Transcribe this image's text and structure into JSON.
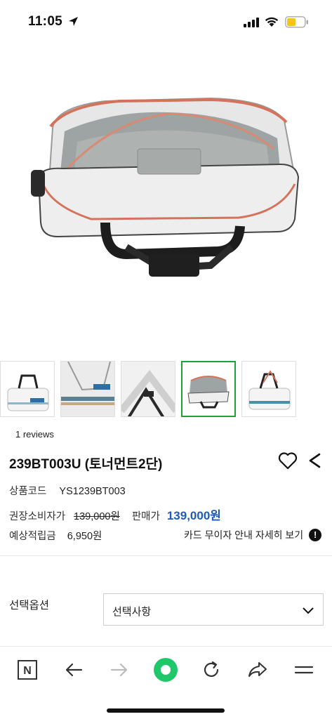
{
  "status_bar": {
    "time": "11:05"
  },
  "gallery": {
    "thumbnail_count": 5,
    "active_index": 3
  },
  "product": {
    "reviews": "1 reviews",
    "name": "239BT003U (토너먼트2단)",
    "code_label": "상품코드",
    "code_value": "YS1239BT003",
    "list_price_label": "권장소비자가",
    "list_price": "139,000원",
    "sale_price_label": "판매가",
    "sale_price": "139,000원",
    "points_label": "예상적립금",
    "points_value": "6,950원",
    "card_info": "카드 무이자 안내 자세히 보기",
    "info_icon_text": "!"
  },
  "options": {
    "label": "선택옵션",
    "selected": "선택사항"
  },
  "colors": {
    "accent_blue": "#1e5bb8",
    "browser_green": "#1ec86a",
    "active_thumb_border": "#1aa33b"
  },
  "bottom_bar": {
    "logo_letter": "N"
  }
}
